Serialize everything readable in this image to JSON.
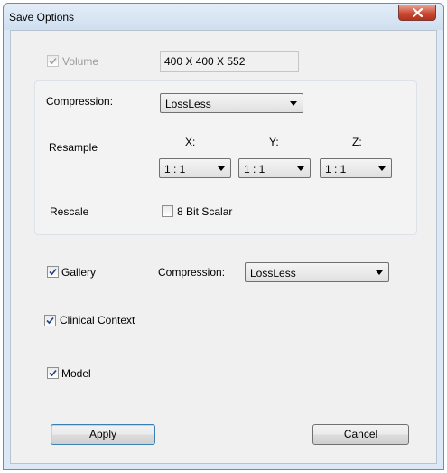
{
  "window": {
    "title": "Save Options",
    "close_icon": "close-x-icon"
  },
  "volume": {
    "label": "Volume",
    "checked": true,
    "enabled": false,
    "dimensions": "400 X 400 X 552"
  },
  "compression": {
    "label": "Compression:",
    "value": "LossLess"
  },
  "resample": {
    "label": "Resample",
    "axes": [
      {
        "label": "X:",
        "value": "1 : 1"
      },
      {
        "label": "Y:",
        "value": "1 : 1"
      },
      {
        "label": "Z:",
        "value": "1 : 1"
      }
    ]
  },
  "rescale": {
    "label": "Rescale",
    "option_label": "8 Bit Scalar",
    "checked": false
  },
  "gallery": {
    "label": "Gallery",
    "checked": true,
    "compression_label": "Compression:",
    "compression_value": "LossLess"
  },
  "clinical_context": {
    "label": "Clinical Context",
    "checked": true
  },
  "model": {
    "label": "Model",
    "checked": true
  },
  "buttons": {
    "apply": "Apply",
    "cancel": "Cancel"
  }
}
